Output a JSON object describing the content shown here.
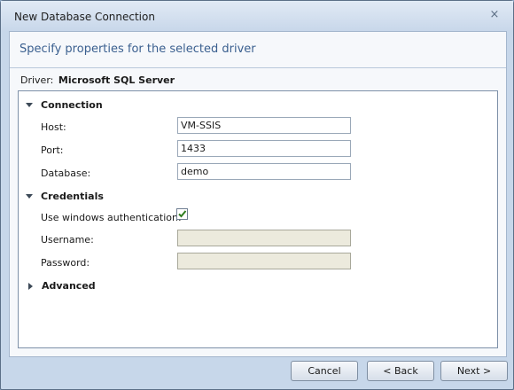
{
  "window": {
    "title": "New Database Connection",
    "close_icon": "×"
  },
  "header": {
    "text": "Specify properties for the selected driver"
  },
  "driver": {
    "label": "Driver:",
    "value": "Microsoft SQL Server"
  },
  "sections": {
    "connection": "Connection",
    "credentials": "Credentials",
    "advanced": "Advanced"
  },
  "fields": {
    "host": {
      "label": "Host:",
      "value": "VM-SSIS"
    },
    "port": {
      "label": "Port:",
      "value": "1433"
    },
    "database": {
      "label": "Database:",
      "value": "demo"
    },
    "windows_auth": {
      "label": "Use windows authentication:",
      "checked": true
    },
    "username": {
      "label": "Username:",
      "value": ""
    },
    "password": {
      "label": "Password:",
      "value": ""
    }
  },
  "buttons": {
    "cancel": "Cancel",
    "back": "< Back",
    "next": "Next >"
  },
  "colors": {
    "header_text": "#3a5f8f",
    "checkmark": "#2f7d1f",
    "disabled_field": "#eceadd"
  },
  "icons": {
    "close": "close-icon",
    "expanded": "chevron-down-icon",
    "collapsed": "chevron-right-icon",
    "check": "checkmark-icon"
  }
}
